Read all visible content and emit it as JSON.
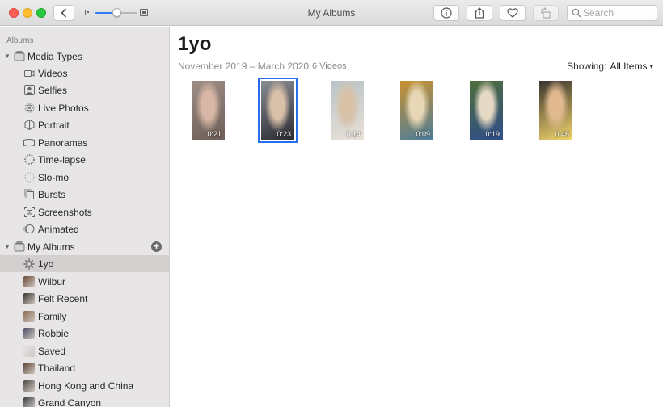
{
  "window": {
    "title": "My Albums"
  },
  "toolbar": {
    "zoom_level": 0.5,
    "search_placeholder": "Search"
  },
  "sidebar": {
    "heading": "Albums",
    "media_types": {
      "label": "Media Types",
      "items": [
        {
          "label": "Videos",
          "icon": "video-icon"
        },
        {
          "label": "Selfies",
          "icon": "selfie-icon"
        },
        {
          "label": "Live Photos",
          "icon": "live-photo-icon"
        },
        {
          "label": "Portrait",
          "icon": "portrait-icon"
        },
        {
          "label": "Panoramas",
          "icon": "panorama-icon"
        },
        {
          "label": "Time-lapse",
          "icon": "time-lapse-icon"
        },
        {
          "label": "Slo-mo",
          "icon": "slo-mo-icon"
        },
        {
          "label": "Bursts",
          "icon": "bursts-icon"
        },
        {
          "label": "Screenshots",
          "icon": "screenshot-icon"
        },
        {
          "label": "Animated",
          "icon": "animated-icon"
        }
      ]
    },
    "my_albums": {
      "label": "My Albums",
      "items": [
        {
          "label": "1yo",
          "selected": true,
          "color": "#8d8782"
        },
        {
          "label": "Wilbur",
          "color": "#6b4a35"
        },
        {
          "label": "Felt Recent",
          "color": "#3a3433"
        },
        {
          "label": "Family",
          "color": "#8a6a52"
        },
        {
          "label": "Robbie",
          "color": "#4a4f66"
        },
        {
          "label": "Saved",
          "color": "#e9e4ea"
        },
        {
          "label": "Thailand",
          "color": "#5b4034"
        },
        {
          "label": "Hong Kong and China",
          "color": "#4f4a45"
        },
        {
          "label": "Grand Canyon",
          "color": "#3c3f47"
        }
      ]
    }
  },
  "main": {
    "title": "1yo",
    "date_range": "November 2019 – March 2020",
    "count": "6 Videos",
    "showing_label": "Showing:",
    "showing_value": "All Items",
    "videos": [
      {
        "duration": "0:21",
        "selected": false,
        "colors": [
          "#9c8d86",
          "#d8b7a6",
          "#6f5f58"
        ]
      },
      {
        "duration": "0:23",
        "selected": true,
        "colors": [
          "#8a8c93",
          "#d9c0a8",
          "#2c2c33"
        ]
      },
      {
        "duration": "0:14",
        "selected": false,
        "colors": [
          "#b9c3c7",
          "#d8c2a8",
          "#e9e1d8"
        ]
      },
      {
        "duration": "0:09",
        "selected": false,
        "colors": [
          "#c8912f",
          "#e7d7b5",
          "#4d7d9a"
        ]
      },
      {
        "duration": "0:19",
        "selected": false,
        "colors": [
          "#4e6e3b",
          "#e6d9c4",
          "#2f4d8a"
        ]
      },
      {
        "duration": "0:46",
        "selected": false,
        "colors": [
          "#3b3430",
          "#e0b98f",
          "#f0d36a"
        ]
      }
    ]
  }
}
